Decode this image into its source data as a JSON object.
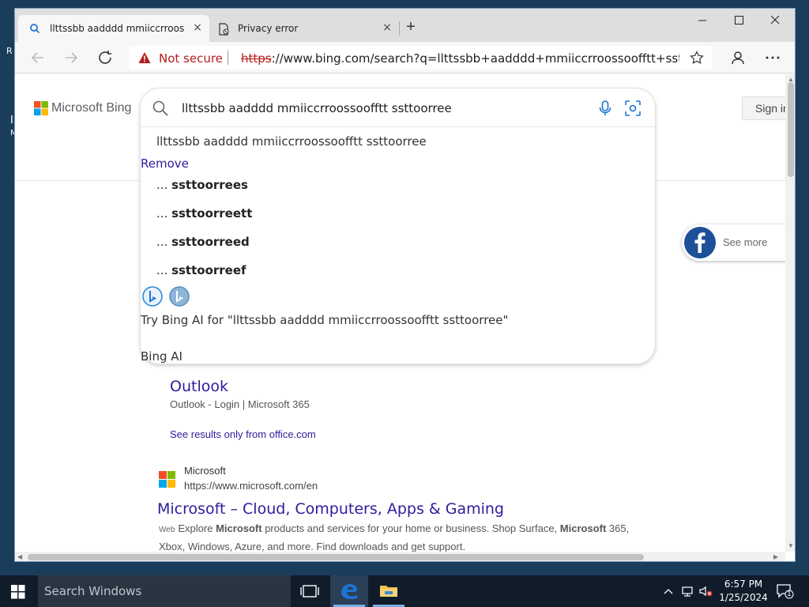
{
  "desktop": {
    "frag_r": "R",
    "frag_i": "I",
    "frag_m": "M"
  },
  "browser": {
    "tabs": [
      {
        "title": "llttssbb aadddd mmiiccrroossoofftt ssttoorree",
        "close": "×"
      },
      {
        "title": "Privacy error",
        "close": "×"
      }
    ],
    "new_tab": "+",
    "address": {
      "security_label": "Not secure",
      "scheme": "https",
      "url_rest": "://www.bing.com/search?q=llttssbb+aadddd+mmiiccrroossoofftt+ssttoo..."
    }
  },
  "page": {
    "logo_text": "Microsoft Bing",
    "sign_in": "Sign in",
    "search": {
      "query": "llttssbb aadddd mmiiccrroossoofftt ssttoorree",
      "suggestions": [
        "llttssbb aadddd mmiiccrroossoofftt ssttoorree",
        {
          "prefix": "... ",
          "bold": "ssttoorrees"
        },
        {
          "prefix": "... ",
          "bold": "ssttoorreett"
        },
        {
          "prefix": "... ",
          "bold": "ssttoorreed"
        },
        {
          "prefix": "... ",
          "bold": "ssttoorreef"
        }
      ],
      "remove_label": "Remove",
      "try_ai": "Try Bing AI for \"llttssbb aadddd mmiiccrroossoofftt ssttoorree\"",
      "bing_ai_label": "Bing AI"
    },
    "see_more": "See more",
    "results": [
      {
        "title": "Outlook",
        "subtitle": "Outlook - Login | Microsoft 365",
        "see_only": "See results only from office.com"
      },
      {
        "site_name": "Microsoft",
        "url": "https://www.microsoft.com/en",
        "title": "Microsoft – Cloud, Computers, Apps & Gaming",
        "web_tag": "Web",
        "desc_1": "Explore ",
        "desc_b1": "Microsoft",
        "desc_2": " products and services for your home or business. Shop Surface, ",
        "desc_b2": "Microsoft",
        "desc_3": " 365, Xbox, Windows, Azure, and more. Find downloads and get support."
      }
    ]
  },
  "taskbar": {
    "search_placeholder": "Search Windows",
    "time": "6:57 PM",
    "date": "1/25/2024",
    "notification_count": "1"
  },
  "colors": {
    "link": "#2c1d9c",
    "not_secure": "#b71c1c",
    "taskbar": "#101c2a",
    "edge_blue": "#1e73d2"
  }
}
